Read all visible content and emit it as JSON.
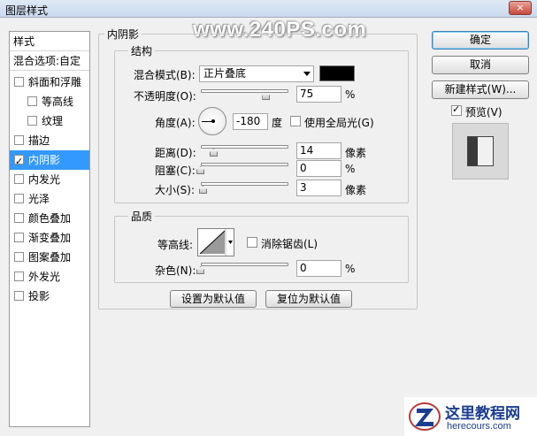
{
  "window": {
    "title": "图层样式",
    "close_label": "×",
    "watermark": "www.240PS.com"
  },
  "sidebar": {
    "header": "样式",
    "blend_options": "混合选项:自定",
    "items": [
      {
        "label": "斜面和浮雕",
        "checked": false
      },
      {
        "label": "等高线",
        "checked": false
      },
      {
        "label": "纹理",
        "checked": false
      },
      {
        "label": "描边",
        "checked": false
      },
      {
        "label": "内阴影",
        "checked": true
      },
      {
        "label": "内发光",
        "checked": false
      },
      {
        "label": "光泽",
        "checked": false
      },
      {
        "label": "颜色叠加",
        "checked": false
      },
      {
        "label": "渐变叠加",
        "checked": false
      },
      {
        "label": "图案叠加",
        "checked": false
      },
      {
        "label": "外发光",
        "checked": false
      },
      {
        "label": "投影",
        "checked": false
      }
    ]
  },
  "panel": {
    "title": "内阴影",
    "structure": {
      "title": "结构",
      "blend_mode_label": "混合模式(B):",
      "blend_mode_value": "正片叠底",
      "shadow_color": "#000000",
      "opacity_label": "不透明度(O):",
      "opacity_value": "75",
      "opacity_fraction": 0.75,
      "percent": "%",
      "angle_label": "角度(A):",
      "angle_value": "-180",
      "angle_unit": "度",
      "global_light_label": "使用全局光(G)",
      "distance_label": "距离(D):",
      "distance_value": "14",
      "distance_unit": "像素",
      "choke_label": "阻塞(C):",
      "choke_value": "0",
      "size_label": "大小(S):",
      "size_value": "3",
      "size_unit": "像素"
    },
    "quality": {
      "title": "品质",
      "contour_label": "等高线:",
      "antialias_label": "消除锯齿(L)",
      "noise_label": "杂色(N):",
      "noise_value": "0"
    },
    "make_default": "设置为默认值",
    "reset_default": "复位为默认值"
  },
  "actions": {
    "ok": "确定",
    "cancel": "取消",
    "new_style": "新建样式(W)...",
    "preview_label": "预览(V)",
    "preview_checked": true
  },
  "logo": {
    "title": "这里教程网",
    "url": "herecours.com"
  }
}
